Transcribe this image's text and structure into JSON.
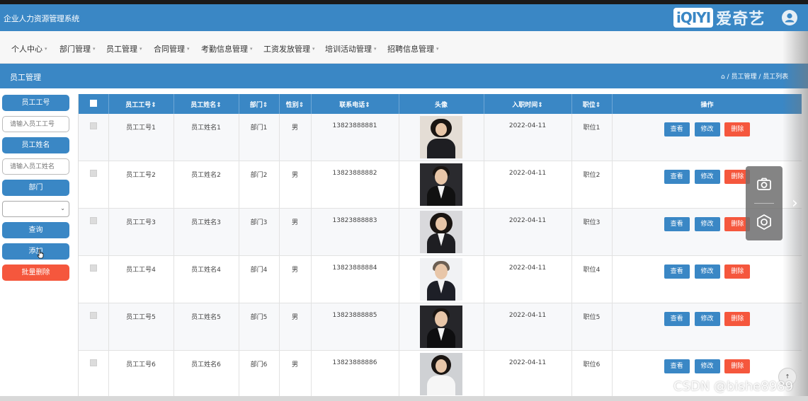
{
  "app": {
    "title": "企业人力资源管理系统",
    "logo_box": "iQIYI",
    "logo_text": "爱奇艺"
  },
  "nav": {
    "items": [
      "个人中心",
      "部门管理",
      "员工管理",
      "合同管理",
      "考勤信息管理",
      "工资发放管理",
      "培训活动管理",
      "招聘信息管理"
    ],
    "caret": "▾"
  },
  "subbar": {
    "title": "员工管理",
    "breadcrumb": "⌂ / 员工管理 / 员工列表"
  },
  "sidebar": {
    "emp_no_label": "员工工号",
    "emp_no_placeholder": "请输入员工工号",
    "emp_name_label": "员工姓名",
    "emp_name_placeholder": "请输入员工姓名",
    "dept_label": "部门",
    "dept_value": "",
    "query_label": "查询",
    "add_label": "添加",
    "batch_delete_label": "批量删除"
  },
  "table": {
    "headers": [
      "员工工号⇕",
      "员工姓名⇕",
      "部门⇕",
      "性别⇕",
      "联系电话⇕",
      "头像",
      "入职时间⇕",
      "职位⇕",
      "操作"
    ],
    "actions": {
      "view": "查看",
      "edit": "修改",
      "delete": "删除"
    },
    "rows": [
      {
        "no": "员工工号1",
        "name": "员工姓名1",
        "dept": "部门1",
        "gender": "男",
        "phone": "13823888881",
        "date": "2022-04-11",
        "position": "职位1"
      },
      {
        "no": "员工工号2",
        "name": "员工姓名2",
        "dept": "部门2",
        "gender": "男",
        "phone": "13823888882",
        "date": "2022-04-11",
        "position": "职位2"
      },
      {
        "no": "员工工号3",
        "name": "员工姓名3",
        "dept": "部门3",
        "gender": "男",
        "phone": "13823888883",
        "date": "2022-04-11",
        "position": "职位3"
      },
      {
        "no": "员工工号4",
        "name": "员工姓名4",
        "dept": "部门4",
        "gender": "男",
        "phone": "13823888884",
        "date": "2022-04-11",
        "position": "职位4"
      },
      {
        "no": "员工工号5",
        "name": "员工姓名5",
        "dept": "部门5",
        "gender": "男",
        "phone": "13823888885",
        "date": "2022-04-11",
        "position": "职位5"
      },
      {
        "no": "员工工号6",
        "name": "员工姓名6",
        "dept": "部门6",
        "gender": "男",
        "phone": "13823888886",
        "date": "2022-04-11",
        "position": "职位6"
      }
    ]
  },
  "overlay": {
    "watermark": "CSDN @bishe8989",
    "next_arrow": "›",
    "scroll_top": "↑"
  },
  "colors": {
    "primary": "#3a87c5",
    "danger": "#f5573d",
    "nav_bg": "#f7f7f7"
  },
  "icons": [
    "user-icon",
    "home-icon",
    "camera-icon",
    "lens-icon",
    "chevron-right-icon",
    "chevron-down-icon",
    "hand-cursor-icon"
  ]
}
